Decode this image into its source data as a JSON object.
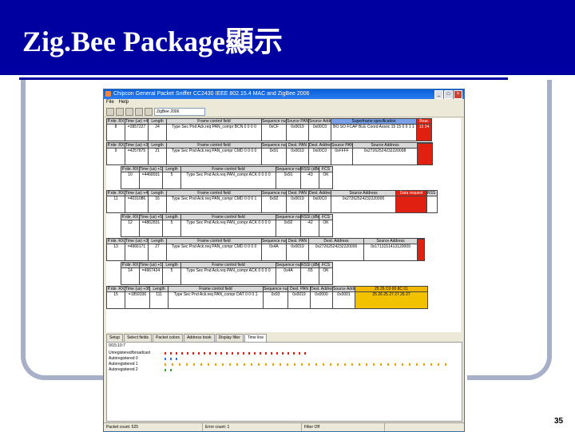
{
  "slide": {
    "title": "Zig.Bee Package顯示",
    "page_number": "35"
  },
  "window": {
    "title": "Chipcon General Packet Sniffer CC2430 IEEE 802.15.4 MAC and ZigBee 2006",
    "menu": [
      "File",
      "Help"
    ],
    "combo": "ZigBee 2006",
    "packets": [
      {
        "fields": [
          {
            "h": "P.nbr. RX",
            "v": "8",
            "w": 22
          },
          {
            "h": "Time (us) +4099",
            "v": "=3957227",
            "w": 28
          },
          {
            "h": "Length",
            "v": "24",
            "w": 22
          },
          {
            "h": "Frame control field",
            "v": "Type Sec Pnd Ack.req PAN_compr BCN 0 0 0 0",
            "w": 118
          },
          {
            "h": "Sequence number",
            "v": "0xCF",
            "w": 30
          },
          {
            "h": "Source PAN",
            "v": "0x0019",
            "w": 27
          },
          {
            "h": "Source Address",
            "v": "0x00C0",
            "w": 27
          },
          {
            "h": "Superframe specification",
            "v": "BO SO FCAP BLE Coord Assoc 15 15 0 0 1 1",
            "w": 106,
            "c": "b"
          },
          {
            "h": "Beac",
            "v": "13 34",
            "w": 18,
            "c": "r"
          }
        ]
      },
      {
        "fields": [
          {
            "h": "P.nbr. RX",
            "v": "9",
            "w": 22
          },
          {
            "h": "Time (us) +300040",
            "v": "=4257875",
            "w": 28
          },
          {
            "h": "Length",
            "v": "21",
            "w": 22
          },
          {
            "h": "Frame control field",
            "v": "Type Sec Pnd Ack.req PAN_compr CMD 0 0 0 0",
            "w": 118
          },
          {
            "h": "Sequence number",
            "v": "0x91",
            "w": 30
          },
          {
            "h": "Dest. PAN",
            "v": "0x0019",
            "w": 27
          },
          {
            "h": "Dest. Address",
            "v": "0x00C0",
            "w": 27
          },
          {
            "h": "Source PAN",
            "v": "0xFFFF",
            "w": 26
          },
          {
            "h": "Source Address",
            "v": "0x27262524232220008",
            "w": 80
          },
          {
            "h": "",
            "v": "",
            "w": 18,
            "c": "r"
          }
        ]
      },
      {
        "fields": [
          {
            "h": "P.nbr. RX",
            "v": "10",
            "w": 22
          },
          {
            "h": "Time (us) +1306",
            "v": "=4468931",
            "w": 28
          },
          {
            "h": "Length",
            "v": "5",
            "w": 22
          },
          {
            "h": "Frame control field",
            "v": "Type Sec Pnd Ack.req PAN_compr ACK 0 0 0 0",
            "w": 118
          },
          {
            "h": "Sequence number",
            "v": "0x91",
            "w": 30
          },
          {
            "h": "RSSI (dBm)",
            "v": "-43",
            "w": 22
          },
          {
            "h": "FCS",
            "v": "OK",
            "w": 16
          }
        ]
      },
      {
        "fields": [
          {
            "h": "P.nbr. RX",
            "v": "11",
            "w": 22
          },
          {
            "h": "Time (us) +454391",
            "v": "=4031086",
            "w": 28
          },
          {
            "h": "Length",
            "v": "16",
            "w": 22
          },
          {
            "h": "Frame control field",
            "v": "Type Sec Pnd Ack.req PAN_compr CMD 0 0 0 1",
            "w": 118
          },
          {
            "h": "Sequence number",
            "v": "0x92",
            "w": 30
          },
          {
            "h": "Dest. PAN",
            "v": "0x0019",
            "w": 27
          },
          {
            "h": "Dest. Address",
            "v": "0x00C0",
            "w": 27
          },
          {
            "h": "Source Address",
            "v": "0x27262524232220000",
            "w": 80
          },
          {
            "h": "Data request",
            "v": "",
            "w": 38,
            "c": "r"
          },
          {
            "h": "RSS (dBi",
            "v": "",
            "w": 12
          }
        ]
      },
      {
        "fields": [
          {
            "h": "P.nbr. RX",
            "v": "12",
            "w": 22
          },
          {
            "h": "Time (us) +500",
            "v": "=4862831",
            "w": 28
          },
          {
            "h": "Length",
            "v": "5",
            "w": 22
          },
          {
            "h": "Frame control field",
            "v": "Type Sec Pnd Ack.req PAN_compr ACK 0 0 0 0",
            "w": 118
          },
          {
            "h": "Sequence number",
            "v": "0x92",
            "w": 30
          },
          {
            "h": "RSSI (dBm)",
            "v": "-42",
            "w": 22
          },
          {
            "h": "FCS",
            "v": "OK",
            "w": 16
          }
        ]
      },
      {
        "fields": [
          {
            "h": "P.nbr. RX",
            "v": "13",
            "w": 22
          },
          {
            "h": "Time (us) +3320",
            "v": "=4966171",
            "w": 28
          },
          {
            "h": "Length",
            "v": "27",
            "w": 22
          },
          {
            "h": "Frame control field",
            "v": "Type Sec Pnd Ack.req PAN_compr CMD 0 0 0 0",
            "w": 118
          },
          {
            "h": "Sequence number",
            "v": "0x4A",
            "w": 30
          },
          {
            "h": "Dest. PAN",
            "v": "0x0019",
            "w": 27
          },
          {
            "h": "Dest. Address",
            "v": "0x27262524232220000",
            "w": 68
          },
          {
            "h": "Source Address",
            "v": "0x1713151413120009",
            "w": 66
          },
          {
            "h": "",
            "v": "",
            "w": 8,
            "c": "r"
          }
        ]
      },
      {
        "fields": [
          {
            "h": "P.nbr. RX",
            "v": "14",
            "w": 22
          },
          {
            "h": "Time (us) +1727",
            "v": "=4967424",
            "w": 28
          },
          {
            "h": "Length",
            "v": "5",
            "w": 22
          },
          {
            "h": "Frame control field",
            "v": "Type Sec Pnd Ack.req PAN_compr ACK 0 0 0 0",
            "w": 118
          },
          {
            "h": "Sequence number",
            "v": "0x4A",
            "w": 30
          },
          {
            "h": "RSSI (dBm)",
            "v": "-55",
            "w": 22
          },
          {
            "h": "FCS",
            "v": "OK",
            "w": 16
          }
        ]
      },
      {
        "fields": [
          {
            "h": "P.nbr. RX",
            "v": "15",
            "w": 22
          },
          {
            "h": "Time (us) +3691915",
            "v": "=1859336",
            "w": 30
          },
          {
            "h": "Length",
            "v": "111",
            "w": 22
          },
          {
            "h": "Frame control field",
            "v": "Type Sec Pnd Ack.req PAN_compr DAT 0 0 0 1",
            "w": 118
          },
          {
            "h": "Sequence number",
            "v": "0x93",
            "w": 30
          },
          {
            "h": "Dest. PAN",
            "v": "0x0019",
            "w": 27
          },
          {
            "h": "Dest. Address",
            "v": "0x0000",
            "w": 27
          },
          {
            "h": "Source Address",
            "v": "0x0001",
            "w": 27
          },
          {
            "h": "25 26 C0 00 8C 01",
            "v": "25 26 25 27 27 26 27",
            "w": 90,
            "c": "y"
          }
        ]
      }
    ],
    "tabs": [
      "Setup",
      "Select fields",
      "Packet colors",
      "Address book",
      "Display filter",
      "Time line"
    ],
    "timeline_header": "0/15:10:7",
    "timeline_rows": [
      "Unregistered/broadcast",
      "Autoregistered 0",
      "Autoregistered 1",
      "Autoregistered 2"
    ],
    "status": [
      "Packet count: 525",
      "Error count: 1",
      "Filter Off"
    ],
    "colors": {
      "accent": "#0000a0",
      "frame": "#a8b0c8"
    }
  }
}
